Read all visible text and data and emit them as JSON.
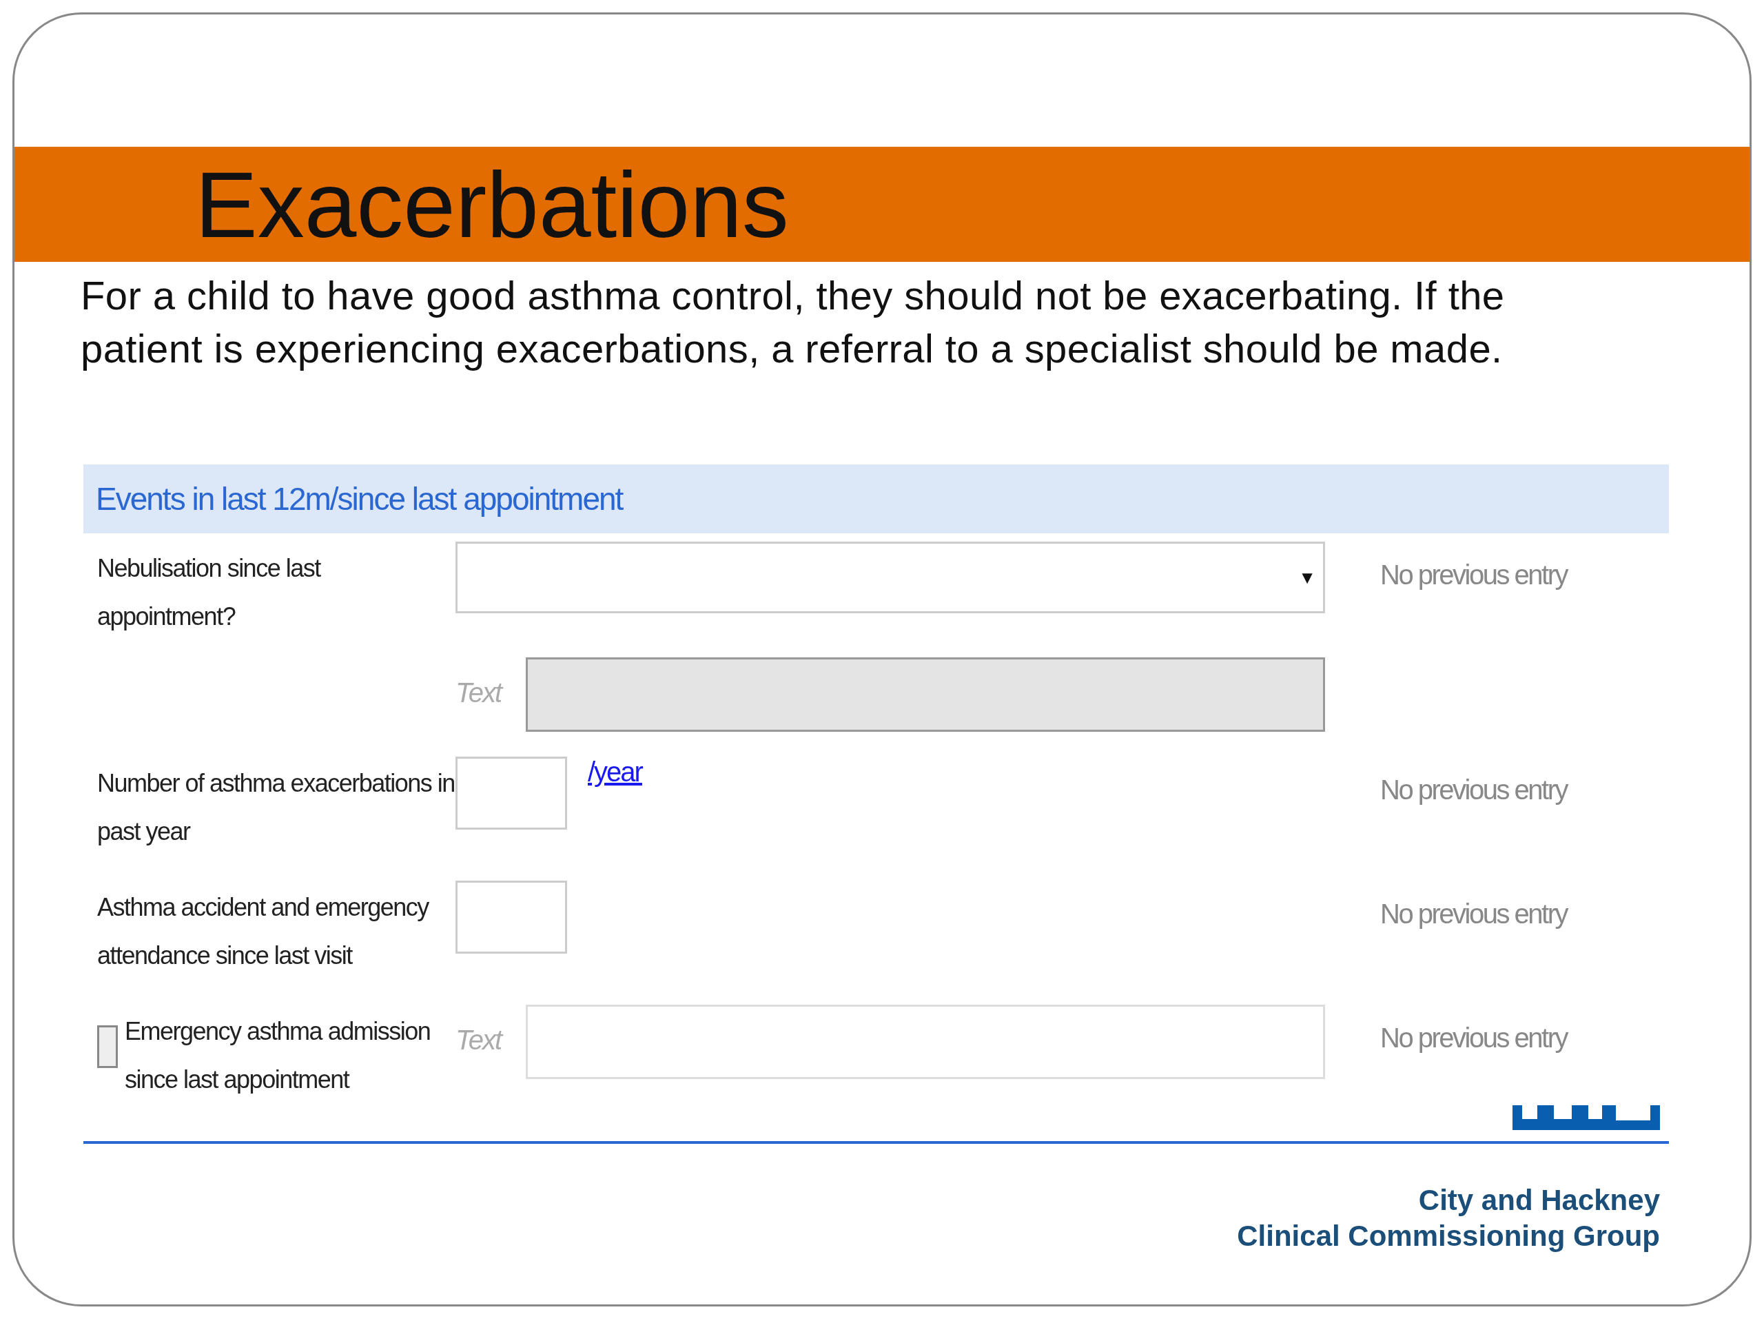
{
  "title": "Exacerbations",
  "intro": "For a child to have good asthma control, they should not be exacerbating. If the patient is experiencing exacerbations, a referral to a specialist should be made.",
  "form": {
    "header": "Events in last 12m/since last appointment",
    "rows": [
      {
        "kind": "select",
        "label": "Nebulisation since last appointment?",
        "arrow": "▼",
        "previous": "No previous entry",
        "detail": {
          "placeholder": "Text",
          "disabled": true
        }
      },
      {
        "kind": "number",
        "label": "Number of asthma exacerbations in past year",
        "unit": "/year",
        "previous": "No previous entry"
      },
      {
        "kind": "number",
        "label": "Asthma accident and emergency attendance since last visit",
        "previous": "No previous entry"
      },
      {
        "kind": "checkbox",
        "label": "Emergency asthma admission since last appointment",
        "checked": false,
        "previous": "No previous entry",
        "detail": {
          "placeholder": "Text",
          "disabled": false
        }
      }
    ]
  },
  "footer": {
    "org_lines": [
      "City and Hackney",
      "Clinical Commissioning Group"
    ]
  }
}
